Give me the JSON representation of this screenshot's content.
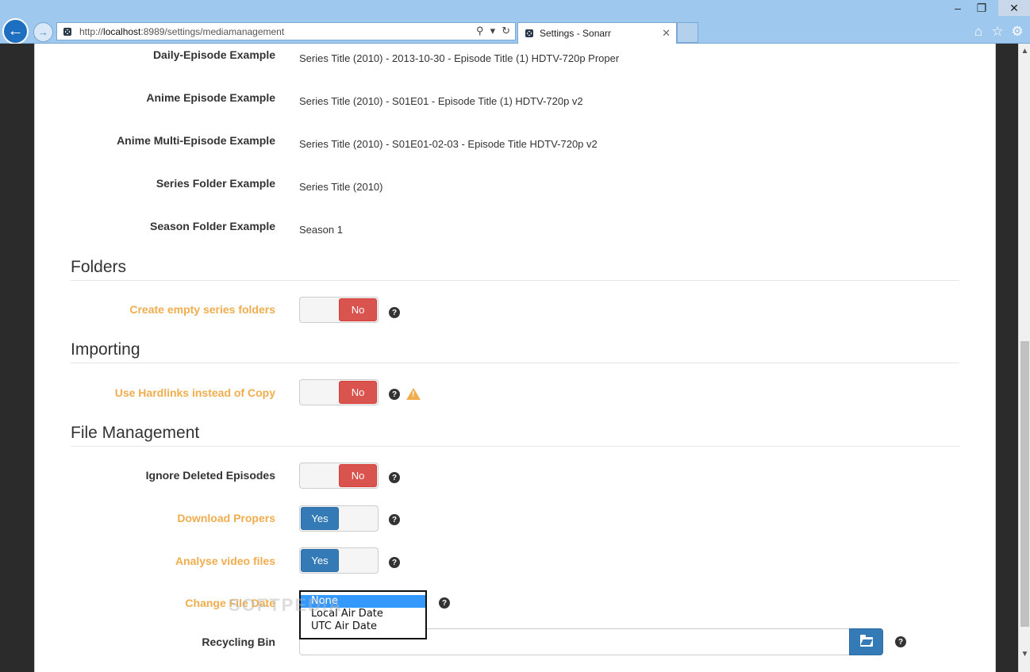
{
  "browser": {
    "url_prefix": "http://",
    "url_host": "localhost",
    "url_path": ":8989/settings/mediamanagement",
    "tab_title": "Settings - Sonarr",
    "controls": {
      "minimize": "‒",
      "restore": "❐",
      "close": "✕"
    },
    "icons": {
      "back": "back-arrow-icon",
      "forward": "forward-arrow-icon",
      "home": "home-icon",
      "favorites": "star-icon",
      "tools": "gear-icon"
    }
  },
  "examples": [
    {
      "label": "Daily-Episode Example",
      "value": "Series Title (2010) - 2013-10-30 - Episode Title (1) HDTV-720p Proper"
    },
    {
      "label": "Anime Episode Example",
      "value": "Series Title (2010) - S01E01 - Episode Title (1) HDTV-720p v2"
    },
    {
      "label": "Anime Multi-Episode Example",
      "value": "Series Title (2010) - S01E01-02-03 - Episode Title HDTV-720p v2"
    },
    {
      "label": "Series Folder Example",
      "value": "Series Title (2010)"
    },
    {
      "label": "Season Folder Example",
      "value": "Season 1"
    }
  ],
  "sections": {
    "folders": "Folders",
    "importing": "Importing",
    "file_management": "File Management"
  },
  "settings": {
    "create_empty_folders": {
      "label": "Create empty series folders",
      "state": "No"
    },
    "use_hardlinks": {
      "label": "Use Hardlinks instead of Copy",
      "state": "No"
    },
    "ignore_deleted": {
      "label": "Ignore Deleted Episodes",
      "state": "No"
    },
    "download_propers": {
      "label": "Download Propers",
      "state": "Yes"
    },
    "analyse_video": {
      "label": "Analyse video files",
      "state": "Yes"
    },
    "change_file_date": {
      "label": "Change File Date",
      "options": [
        "None",
        "Local Air Date",
        "UTC Air Date"
      ],
      "selected": "None"
    },
    "recycling_bin": {
      "label": "Recycling Bin",
      "value": ""
    }
  },
  "help_glyph": "?",
  "warning_glyph": "!",
  "watermark": "SOFTPEDIA"
}
